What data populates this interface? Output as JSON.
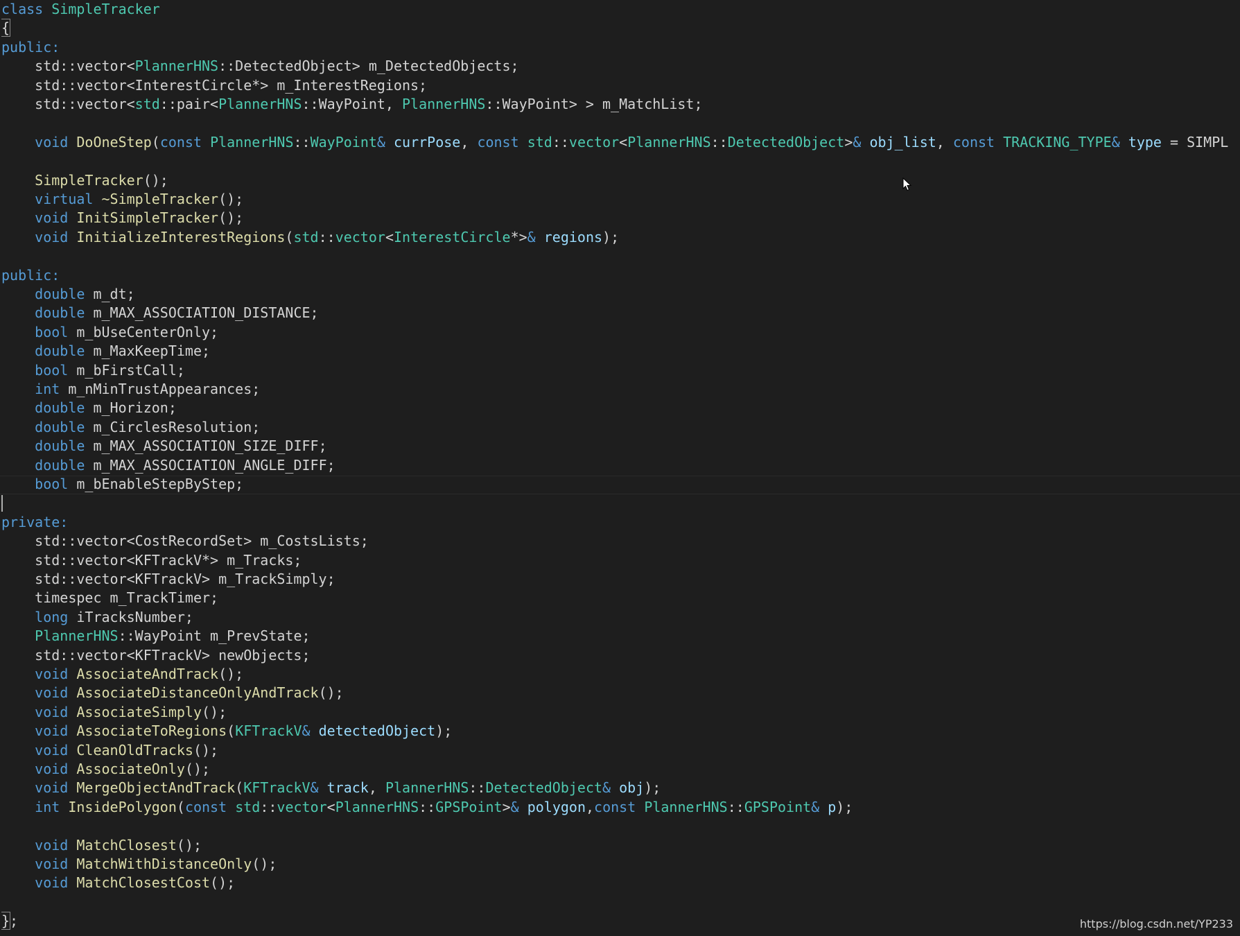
{
  "colors": {
    "background": "#1e1e1e",
    "keyword": "#569cd6",
    "type": "#4ec9b0",
    "function": "#dcdcaa",
    "parameter": "#9cdcfe",
    "text": "#d4d4d4"
  },
  "editor": {
    "lines": [
      [
        [
          "k",
          "class"
        ],
        [
          "o",
          " "
        ],
        [
          "t",
          "SimpleTracker"
        ]
      ],
      [
        [
          "b",
          "{"
        ]
      ],
      [
        [
          "k",
          "public:"
        ]
      ],
      [
        [
          "o",
          "    std::vector<"
        ],
        [
          "t",
          "PlannerHNS"
        ],
        [
          "o",
          "::DetectedObject> m_DetectedObjects;"
        ]
      ],
      [
        [
          "o",
          "    std::vector<InterestCircle*> m_InterestRegions;"
        ]
      ],
      [
        [
          "o",
          "    std::vector<"
        ],
        [
          "t",
          "std"
        ],
        [
          "o",
          "::pair<"
        ],
        [
          "t",
          "PlannerHNS"
        ],
        [
          "o",
          "::WayPoint, "
        ],
        [
          "t",
          "PlannerHNS"
        ],
        [
          "o",
          "::WayPoint> > m_MatchList;"
        ]
      ],
      [],
      [
        [
          "o",
          "    "
        ],
        [
          "k",
          "void"
        ],
        [
          "o",
          " "
        ],
        [
          "f",
          "DoOneStep"
        ],
        [
          "o",
          "("
        ],
        [
          "k",
          "const"
        ],
        [
          "o",
          " "
        ],
        [
          "t",
          "PlannerHNS"
        ],
        [
          "o",
          "::"
        ],
        [
          "t",
          "WayPoint"
        ],
        [
          "k",
          "&"
        ],
        [
          "o",
          " "
        ],
        [
          "p",
          "currPose"
        ],
        [
          "o",
          ", "
        ],
        [
          "k",
          "const"
        ],
        [
          "o",
          " "
        ],
        [
          "t",
          "std"
        ],
        [
          "o",
          "::"
        ],
        [
          "t",
          "vector"
        ],
        [
          "o",
          "<"
        ],
        [
          "t",
          "PlannerHNS"
        ],
        [
          "o",
          "::"
        ],
        [
          "t",
          "DetectedObject"
        ],
        [
          "o",
          ">"
        ],
        [
          "k",
          "&"
        ],
        [
          "o",
          " "
        ],
        [
          "p",
          "obj_list"
        ],
        [
          "o",
          ", "
        ],
        [
          "k",
          "const"
        ],
        [
          "o",
          " "
        ],
        [
          "t",
          "TRACKING_TYPE"
        ],
        [
          "k",
          "&"
        ],
        [
          "o",
          " "
        ],
        [
          "p",
          "type"
        ],
        [
          "o",
          " = SIMPL"
        ]
      ],
      [],
      [
        [
          "o",
          "    "
        ],
        [
          "f",
          "SimpleTracker"
        ],
        [
          "o",
          "();"
        ]
      ],
      [
        [
          "o",
          "    "
        ],
        [
          "k",
          "virtual"
        ],
        [
          "o",
          " "
        ],
        [
          "f",
          "~SimpleTracker"
        ],
        [
          "o",
          "();"
        ]
      ],
      [
        [
          "o",
          "    "
        ],
        [
          "k",
          "void"
        ],
        [
          "o",
          " "
        ],
        [
          "f",
          "InitSimpleTracker"
        ],
        [
          "o",
          "();"
        ]
      ],
      [
        [
          "o",
          "    "
        ],
        [
          "k",
          "void"
        ],
        [
          "o",
          " "
        ],
        [
          "f",
          "InitializeInterestRegions"
        ],
        [
          "o",
          "("
        ],
        [
          "t",
          "std"
        ],
        [
          "o",
          "::"
        ],
        [
          "t",
          "vector"
        ],
        [
          "o",
          "<"
        ],
        [
          "t",
          "InterestCircle"
        ],
        [
          "o",
          "*>"
        ],
        [
          "k",
          "&"
        ],
        [
          "o",
          " "
        ],
        [
          "p",
          "regions"
        ],
        [
          "o",
          ");"
        ]
      ],
      [],
      [
        [
          "k",
          "public:"
        ]
      ],
      [
        [
          "o",
          "    "
        ],
        [
          "k",
          "double"
        ],
        [
          "o",
          " m_dt;"
        ]
      ],
      [
        [
          "o",
          "    "
        ],
        [
          "k",
          "double"
        ],
        [
          "o",
          " m_MAX_ASSOCIATION_DISTANCE;"
        ]
      ],
      [
        [
          "o",
          "    "
        ],
        [
          "k",
          "bool"
        ],
        [
          "o",
          " m_bUseCenterOnly;"
        ]
      ],
      [
        [
          "o",
          "    "
        ],
        [
          "k",
          "double"
        ],
        [
          "o",
          " m_MaxKeepTime;"
        ]
      ],
      [
        [
          "o",
          "    "
        ],
        [
          "k",
          "bool"
        ],
        [
          "o",
          " m_bFirstCall;"
        ]
      ],
      [
        [
          "o",
          "    "
        ],
        [
          "k",
          "int"
        ],
        [
          "o",
          " m_nMinTrustAppearances;"
        ]
      ],
      [
        [
          "o",
          "    "
        ],
        [
          "k",
          "double"
        ],
        [
          "o",
          " m_Horizon;"
        ]
      ],
      [
        [
          "o",
          "    "
        ],
        [
          "k",
          "double"
        ],
        [
          "o",
          " m_CirclesResolution;"
        ]
      ],
      [
        [
          "o",
          "    "
        ],
        [
          "k",
          "double"
        ],
        [
          "o",
          " m_MAX_ASSOCIATION_SIZE_DIFF;"
        ]
      ],
      [
        [
          "o",
          "    "
        ],
        [
          "k",
          "double"
        ],
        [
          "o",
          " m_MAX_ASSOCIATION_ANGLE_DIFF;"
        ]
      ],
      [
        [
          "o",
          "    "
        ],
        [
          "k",
          "bool"
        ],
        [
          "o",
          " m_bEnableStepByStep;"
        ]
      ],
      [],
      [
        [
          "k",
          "private:"
        ]
      ],
      [
        [
          "o",
          "    std::vector<CostRecordSet> m_CostsLists;"
        ]
      ],
      [
        [
          "o",
          "    std::vector<KFTrackV*> m_Tracks;"
        ]
      ],
      [
        [
          "o",
          "    std::vector<KFTrackV> m_TrackSimply;"
        ]
      ],
      [
        [
          "o",
          "    timespec m_TrackTimer;"
        ]
      ],
      [
        [
          "o",
          "    "
        ],
        [
          "k",
          "long"
        ],
        [
          "o",
          " iTracksNumber;"
        ]
      ],
      [
        [
          "o",
          "    "
        ],
        [
          "t",
          "PlannerHNS"
        ],
        [
          "o",
          "::WayPoint m_PrevState;"
        ]
      ],
      [
        [
          "o",
          "    std::vector<KFTrackV> newObjects;"
        ]
      ],
      [
        [
          "o",
          "    "
        ],
        [
          "k",
          "void"
        ],
        [
          "o",
          " "
        ],
        [
          "f",
          "AssociateAndTrack"
        ],
        [
          "o",
          "();"
        ]
      ],
      [
        [
          "o",
          "    "
        ],
        [
          "k",
          "void"
        ],
        [
          "o",
          " "
        ],
        [
          "f",
          "AssociateDistanceOnlyAndTrack"
        ],
        [
          "o",
          "();"
        ]
      ],
      [
        [
          "o",
          "    "
        ],
        [
          "k",
          "void"
        ],
        [
          "o",
          " "
        ],
        [
          "f",
          "AssociateSimply"
        ],
        [
          "o",
          "();"
        ]
      ],
      [
        [
          "o",
          "    "
        ],
        [
          "k",
          "void"
        ],
        [
          "o",
          " "
        ],
        [
          "f",
          "AssociateToRegions"
        ],
        [
          "o",
          "("
        ],
        [
          "t",
          "KFTrackV"
        ],
        [
          "k",
          "&"
        ],
        [
          "o",
          " "
        ],
        [
          "p",
          "detectedObject"
        ],
        [
          "o",
          ");"
        ]
      ],
      [
        [
          "o",
          "    "
        ],
        [
          "k",
          "void"
        ],
        [
          "o",
          " "
        ],
        [
          "f",
          "CleanOldTracks"
        ],
        [
          "o",
          "();"
        ]
      ],
      [
        [
          "o",
          "    "
        ],
        [
          "k",
          "void"
        ],
        [
          "o",
          " "
        ],
        [
          "f",
          "AssociateOnly"
        ],
        [
          "o",
          "();"
        ]
      ],
      [
        [
          "o",
          "    "
        ],
        [
          "k",
          "void"
        ],
        [
          "o",
          " "
        ],
        [
          "f",
          "MergeObjectAndTrack"
        ],
        [
          "o",
          "("
        ],
        [
          "t",
          "KFTrackV"
        ],
        [
          "k",
          "&"
        ],
        [
          "o",
          " "
        ],
        [
          "p",
          "track"
        ],
        [
          "o",
          ", "
        ],
        [
          "t",
          "PlannerHNS"
        ],
        [
          "o",
          "::"
        ],
        [
          "t",
          "DetectedObject"
        ],
        [
          "k",
          "&"
        ],
        [
          "o",
          " "
        ],
        [
          "p",
          "obj"
        ],
        [
          "o",
          ");"
        ]
      ],
      [
        [
          "o",
          "    "
        ],
        [
          "k",
          "int"
        ],
        [
          "o",
          " "
        ],
        [
          "f",
          "InsidePolygon"
        ],
        [
          "o",
          "("
        ],
        [
          "k",
          "const"
        ],
        [
          "o",
          " "
        ],
        [
          "t",
          "std"
        ],
        [
          "o",
          "::"
        ],
        [
          "t",
          "vector"
        ],
        [
          "o",
          "<"
        ],
        [
          "t",
          "PlannerHNS"
        ],
        [
          "o",
          "::"
        ],
        [
          "t",
          "GPSPoint"
        ],
        [
          "o",
          ">"
        ],
        [
          "k",
          "&"
        ],
        [
          "o",
          " "
        ],
        [
          "p",
          "polygon"
        ],
        [
          "o",
          ","
        ],
        [
          "k",
          "const"
        ],
        [
          "o",
          " "
        ],
        [
          "t",
          "PlannerHNS"
        ],
        [
          "o",
          "::"
        ],
        [
          "t",
          "GPSPoint"
        ],
        [
          "k",
          "&"
        ],
        [
          "o",
          " "
        ],
        [
          "p",
          "p"
        ],
        [
          "o",
          ");"
        ]
      ],
      [],
      [
        [
          "o",
          "    "
        ],
        [
          "k",
          "void"
        ],
        [
          "o",
          " "
        ],
        [
          "f",
          "MatchClosest"
        ],
        [
          "o",
          "();"
        ]
      ],
      [
        [
          "o",
          "    "
        ],
        [
          "k",
          "void"
        ],
        [
          "o",
          " "
        ],
        [
          "f",
          "MatchWithDistanceOnly"
        ],
        [
          "o",
          "();"
        ]
      ],
      [
        [
          "o",
          "    "
        ],
        [
          "k",
          "void"
        ],
        [
          "o",
          " "
        ],
        [
          "f",
          "MatchClosestCost"
        ],
        [
          "o",
          "();"
        ]
      ],
      [],
      [
        [
          "b",
          "}"
        ],
        [
          "o",
          ";"
        ]
      ]
    ]
  },
  "watermark": "https://blog.csdn.net/YP233"
}
